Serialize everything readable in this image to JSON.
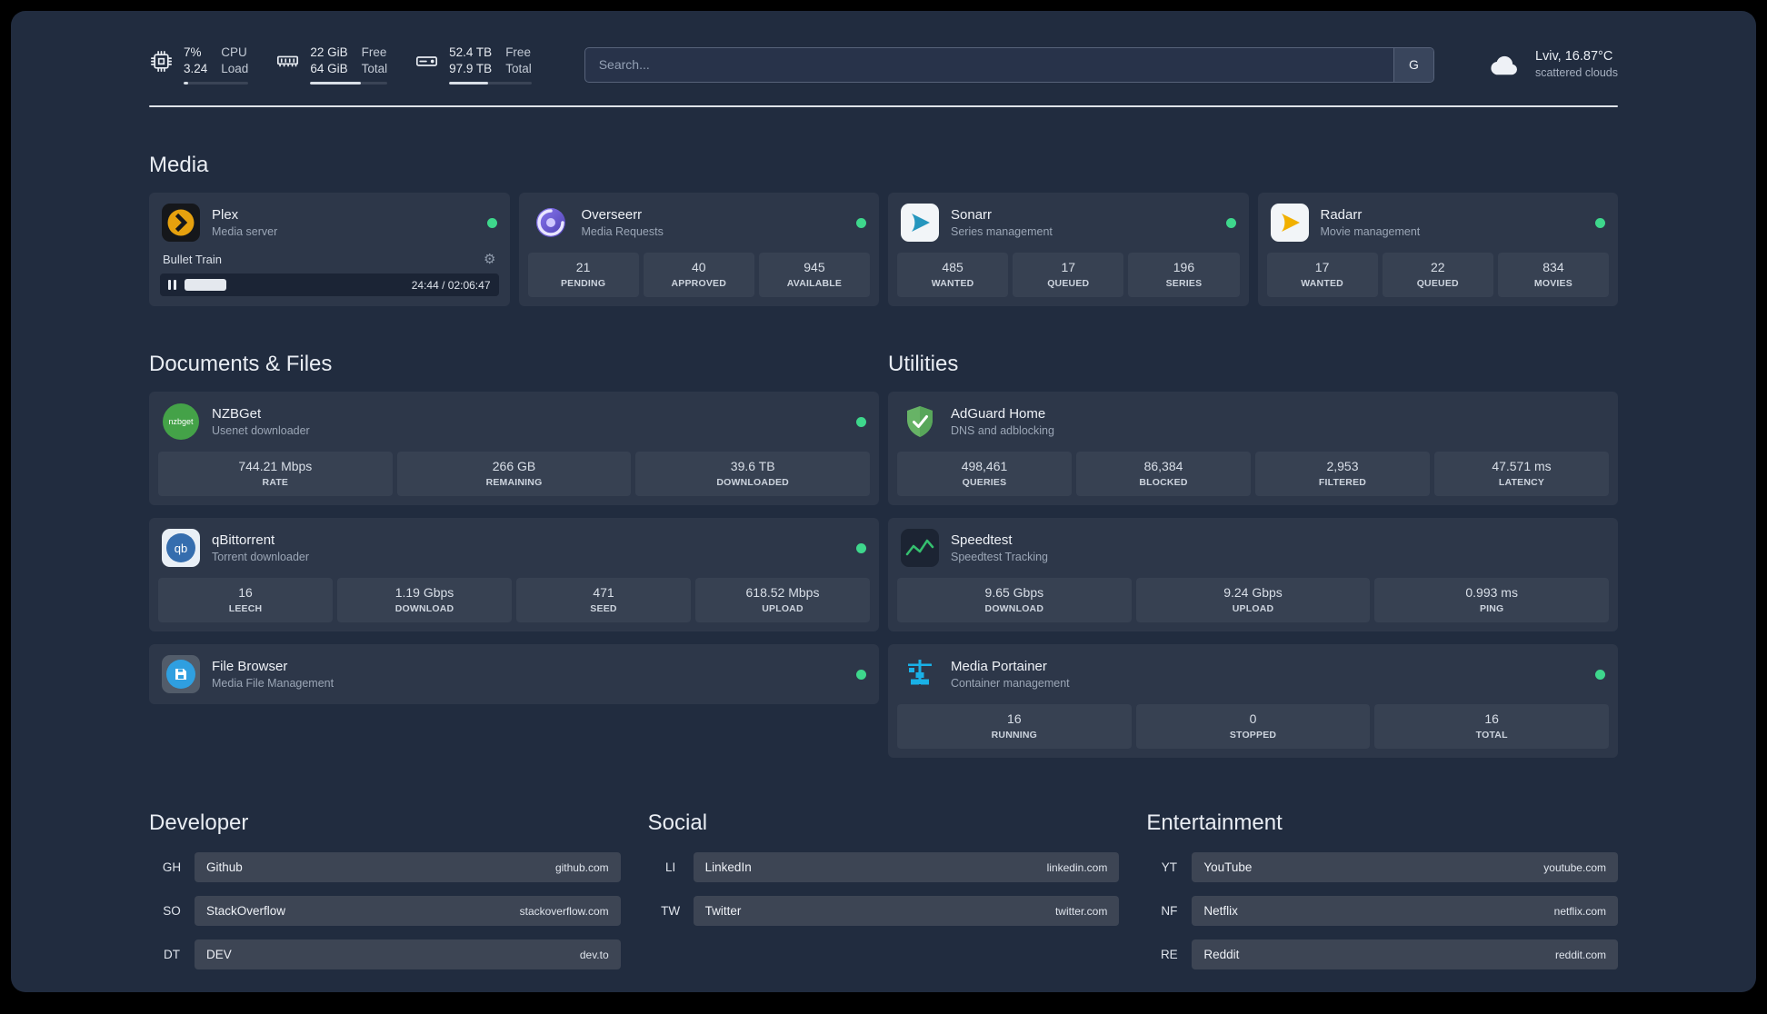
{
  "topbar": {
    "cpu": {
      "value1": "7%",
      "value2": "3.24",
      "label1": "CPU",
      "label2": "Load",
      "progress": 7
    },
    "memory": {
      "value1": "22 GiB",
      "value2": "64 GiB",
      "label1": "Free",
      "label2": "Total",
      "progress": 66
    },
    "disk": {
      "value1": "52.4 TB",
      "value2": "97.9 TB",
      "label1": "Free",
      "label2": "Total",
      "progress": 47
    },
    "search": {
      "placeholder": "Search...",
      "provider": "G"
    },
    "weather": {
      "location": "Lviv, 16.87°C",
      "condition": "scattered clouds"
    }
  },
  "sections": {
    "media": {
      "title": "Media",
      "plex": {
        "name": "Plex",
        "desc": "Media server",
        "track": "Bullet Train",
        "time": "24:44 / 02:06:47",
        "progress": 19
      },
      "overseerr": {
        "name": "Overseerr",
        "desc": "Media Requests",
        "stats": [
          {
            "value": "21",
            "label": "PENDING"
          },
          {
            "value": "40",
            "label": "APPROVED"
          },
          {
            "value": "945",
            "label": "AVAILABLE"
          }
        ]
      },
      "sonarr": {
        "name": "Sonarr",
        "desc": "Series management",
        "stats": [
          {
            "value": "485",
            "label": "WANTED"
          },
          {
            "value": "17",
            "label": "QUEUED"
          },
          {
            "value": "196",
            "label": "SERIES"
          }
        ]
      },
      "radarr": {
        "name": "Radarr",
        "desc": "Movie management",
        "stats": [
          {
            "value": "17",
            "label": "WANTED"
          },
          {
            "value": "22",
            "label": "QUEUED"
          },
          {
            "value": "834",
            "label": "MOVIES"
          }
        ]
      }
    },
    "documents": {
      "title": "Documents & Files",
      "nzbget": {
        "name": "NZBGet",
        "desc": "Usenet downloader",
        "stats": [
          {
            "value": "744.21 Mbps",
            "label": "RATE"
          },
          {
            "value": "266 GB",
            "label": "REMAINING"
          },
          {
            "value": "39.6 TB",
            "label": "DOWNLOADED"
          }
        ]
      },
      "qbittorrent": {
        "name": "qBittorrent",
        "desc": "Torrent downloader",
        "stats": [
          {
            "value": "16",
            "label": "LEECH"
          },
          {
            "value": "1.19 Gbps",
            "label": "DOWNLOAD"
          },
          {
            "value": "471",
            "label": "SEED"
          },
          {
            "value": "618.52 Mbps",
            "label": "UPLOAD"
          }
        ]
      },
      "filebrowser": {
        "name": "File Browser",
        "desc": "Media File Management"
      }
    },
    "utilities": {
      "title": "Utilities",
      "adguard": {
        "name": "AdGuard Home",
        "desc": "DNS and adblocking",
        "stats": [
          {
            "value": "498,461",
            "label": "QUERIES"
          },
          {
            "value": "86,384",
            "label": "BLOCKED"
          },
          {
            "value": "2,953",
            "label": "FILTERED"
          },
          {
            "value": "47.571 ms",
            "label": "LATENCY"
          }
        ]
      },
      "speedtest": {
        "name": "Speedtest",
        "desc": "Speedtest Tracking",
        "stats": [
          {
            "value": "9.65 Gbps",
            "label": "DOWNLOAD"
          },
          {
            "value": "9.24 Gbps",
            "label": "UPLOAD"
          },
          {
            "value": "0.993 ms",
            "label": "PING"
          }
        ]
      },
      "portainer": {
        "name": "Media Portainer",
        "desc": "Container management",
        "stats": [
          {
            "value": "16",
            "label": "RUNNING"
          },
          {
            "value": "0",
            "label": "STOPPED"
          },
          {
            "value": "16",
            "label": "TOTAL"
          }
        ]
      }
    }
  },
  "bookmarks": {
    "developer": {
      "title": "Developer",
      "items": [
        {
          "abbr": "GH",
          "name": "Github",
          "domain": "github.com"
        },
        {
          "abbr": "SO",
          "name": "StackOverflow",
          "domain": "stackoverflow.com"
        },
        {
          "abbr": "DT",
          "name": "DEV",
          "domain": "dev.to"
        }
      ]
    },
    "social": {
      "title": "Social",
      "items": [
        {
          "abbr": "LI",
          "name": "LinkedIn",
          "domain": "linkedin.com"
        },
        {
          "abbr": "TW",
          "name": "Twitter",
          "domain": "twitter.com"
        }
      ]
    },
    "entertainment": {
      "title": "Entertainment",
      "items": [
        {
          "abbr": "YT",
          "name": "YouTube",
          "domain": "youtube.com"
        },
        {
          "abbr": "NF",
          "name": "Netflix",
          "domain": "netflix.com"
        },
        {
          "abbr": "RE",
          "name": "Reddit",
          "domain": "reddit.com"
        }
      ]
    }
  }
}
